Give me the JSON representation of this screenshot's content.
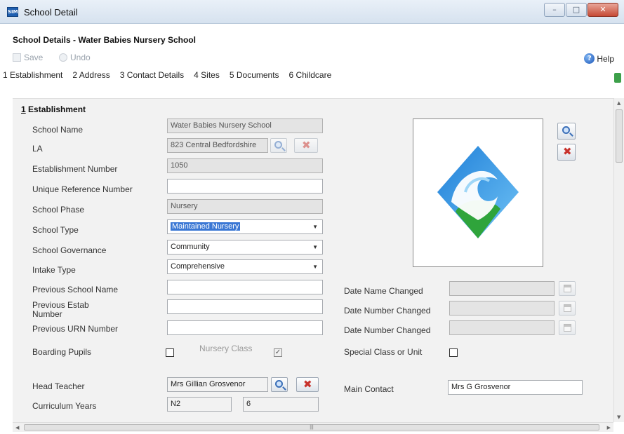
{
  "window": {
    "title": "School Detail",
    "app_icon": "app-icon",
    "controls": [
      "minimize",
      "maximize",
      "close"
    ]
  },
  "header": {
    "title": "School Details - Water Babies Nursery School",
    "save_label": "Save",
    "undo_label": "Undo",
    "help_label": "Help"
  },
  "tabs": [
    {
      "label": "1 Establishment"
    },
    {
      "label": "2 Address"
    },
    {
      "label": "3 Contact Details"
    },
    {
      "label": "4 Sites"
    },
    {
      "label": "5 Documents"
    },
    {
      "label": "6 Childcare"
    }
  ],
  "section": {
    "number": "1",
    "title": "Establishment"
  },
  "fields": {
    "school_name": {
      "label": "School Name",
      "value": "Water Babies Nursery School"
    },
    "la": {
      "label": "LA",
      "value": "823 Central Bedfordshire"
    },
    "establishment_number": {
      "label": "Establishment Number",
      "value": "1050"
    },
    "urn": {
      "label": "Unique Reference Number",
      "value": ""
    },
    "school_phase": {
      "label": "School Phase",
      "value": "Nursery"
    },
    "school_type": {
      "label": "School Type",
      "value": "Maintained Nursery"
    },
    "school_governance": {
      "label": "School Governance",
      "value": "Community"
    },
    "intake_type": {
      "label": "Intake Type",
      "value": "Comprehensive"
    },
    "previous_school_name": {
      "label": "Previous School Name",
      "value": ""
    },
    "previous_estab_number": {
      "label": "Previous Estab Number",
      "value": ""
    },
    "previous_urn_number": {
      "label": "Previous URN Number",
      "value": ""
    },
    "boarding_pupils": {
      "label": "Boarding Pupils",
      "checked": false
    },
    "nursery_class": {
      "label": "Nursery Class",
      "checked": true
    },
    "head_teacher": {
      "label": "Head Teacher",
      "value": "Mrs Gillian Grosvenor"
    },
    "curriculum_years": {
      "label": "Curriculum Years",
      "from": "N2",
      "to": "6"
    },
    "date_name_changed": {
      "label": "Date Name Changed",
      "value": ""
    },
    "date_number_changed": {
      "label": "Date Number Changed",
      "value": ""
    },
    "date_number_changed_2": {
      "label": "Date Number Changed",
      "value": ""
    },
    "special_class": {
      "label": "Special Class or Unit",
      "checked": false
    },
    "main_contact": {
      "label": "Main Contact",
      "value": "Mrs G Grosvenor"
    }
  },
  "icons": {
    "search": "search-icon",
    "delete": "delete-icon",
    "calendar": "calendar-icon",
    "logo": "wave-logo-icon"
  },
  "colors": {
    "selection": "#3a77d4",
    "logo_blue": "#1f7fd8",
    "logo_green": "#2fa43b"
  }
}
